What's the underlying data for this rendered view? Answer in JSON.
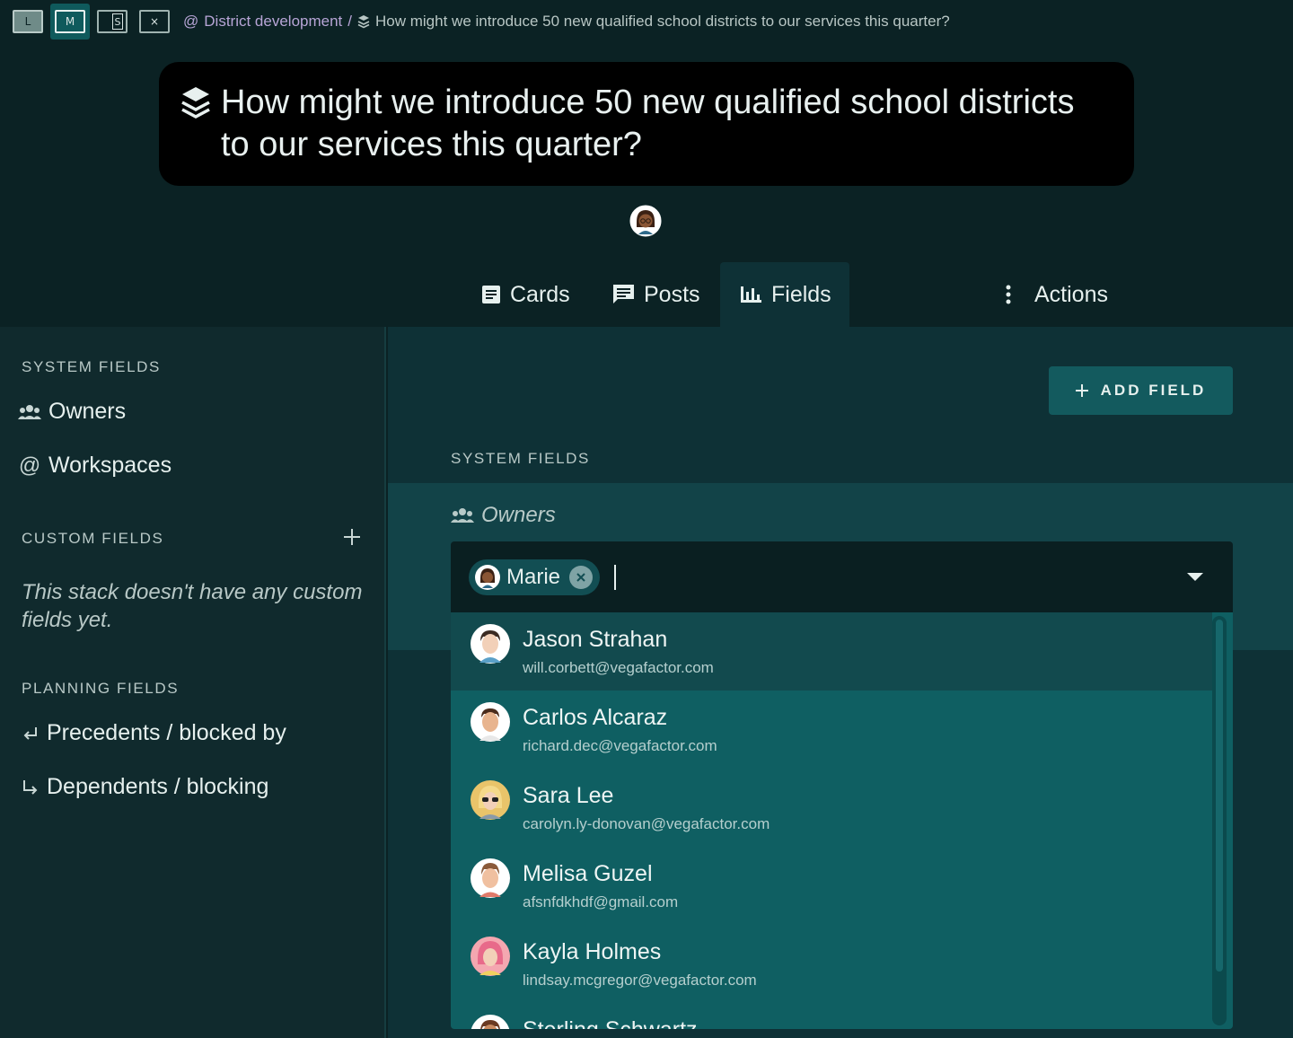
{
  "topbar": {
    "sizes": [
      "L",
      "M",
      "S"
    ],
    "close_label": "×",
    "breadcrumb": {
      "workspace": "District development",
      "separator": "/",
      "current": "How might we introduce 50 new qualified school districts to our services this quarter?"
    }
  },
  "stack": {
    "title": "How might we introduce 50 new qualified school districts to our services this quarter?"
  },
  "tabs": [
    {
      "label": "Cards",
      "icon": "document-icon"
    },
    {
      "label": "Posts",
      "icon": "message-icon"
    },
    {
      "label": "Fields",
      "icon": "bar-chart-icon",
      "active": true
    },
    {
      "label": "Actions",
      "icon": "more-vertical-icon"
    }
  ],
  "sidebar": {
    "system_label": "SYSTEM FIELDS",
    "system_items": [
      {
        "label": "Owners",
        "icon": "people-icon"
      },
      {
        "label": "Workspaces",
        "icon": "at-icon"
      }
    ],
    "custom_label": "CUSTOM FIELDS",
    "custom_empty": "This stack doesn't have any custom fields yet.",
    "planning_label": "PLANNING FIELDS",
    "planning_items": [
      {
        "label": "Precedents / blocked by",
        "icon": "return-arrow-icon"
      },
      {
        "label": "Dependents / blocking",
        "icon": "subdirectory-arrow-icon"
      }
    ]
  },
  "main": {
    "add_field_label": "ADD FIELD",
    "system_label": "SYSTEM FIELDS",
    "owners_label": "Owners",
    "selected_owner": "Marie",
    "options": [
      {
        "name": "Jason Strahan",
        "email": "will.corbett@vegafactor.com"
      },
      {
        "name": "Carlos Alcaraz",
        "email": "richard.dec@vegafactor.com"
      },
      {
        "name": "Sara Lee",
        "email": "carolyn.ly-donovan@vegafactor.com"
      },
      {
        "name": "Melisa Guzel",
        "email": "afsnfdkhdf@gmail.com"
      },
      {
        "name": "Kayla Holmes",
        "email": "lindsay.mcgregor@vegafactor.com"
      },
      {
        "name": "Sterling Schwartz",
        "email": ""
      }
    ]
  },
  "colors": {
    "background": "#0b2224",
    "panel": "#0e3136",
    "accent": "#135a5e",
    "dropdown": "#0f5f62",
    "breadcrumb": "#b7a5d6"
  }
}
